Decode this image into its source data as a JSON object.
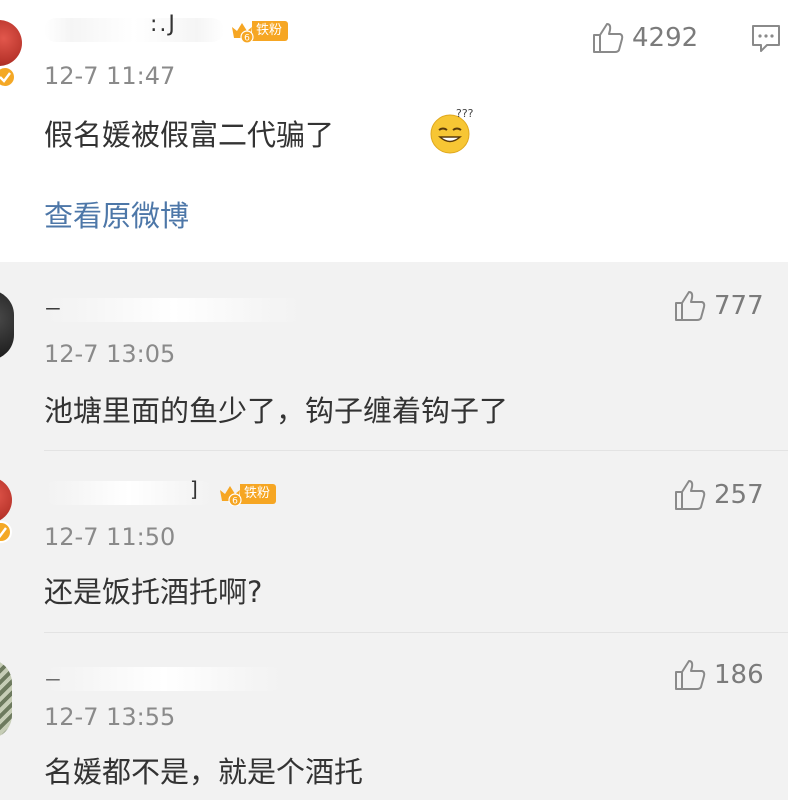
{
  "post": {
    "time": "12-7 11:47",
    "text": "假名媛被假富二代骗了",
    "emoji": "sweat-smile-emoji",
    "view_original": "查看原微博",
    "likes": "4292",
    "fan_badge": "铁粉",
    "fan_level": "6"
  },
  "replies": [
    {
      "time": "12-7 13:05",
      "text": "池塘里面的鱼少了，钩子缠着钩子了",
      "likes": "777"
    },
    {
      "time": "12-7 11:50",
      "text": "还是饭托酒托啊?",
      "likes": "257",
      "fan_badge": "铁粉",
      "fan_level": "6"
    },
    {
      "time": "12-7 13:55",
      "text": "名媛都不是，就是个酒托",
      "likes": "186"
    }
  ],
  "colors": {
    "link": "#4d77a8",
    "fan_badge": "#f6a623",
    "reply_bg": "#f2f2f2",
    "time": "#8a8a8a"
  }
}
